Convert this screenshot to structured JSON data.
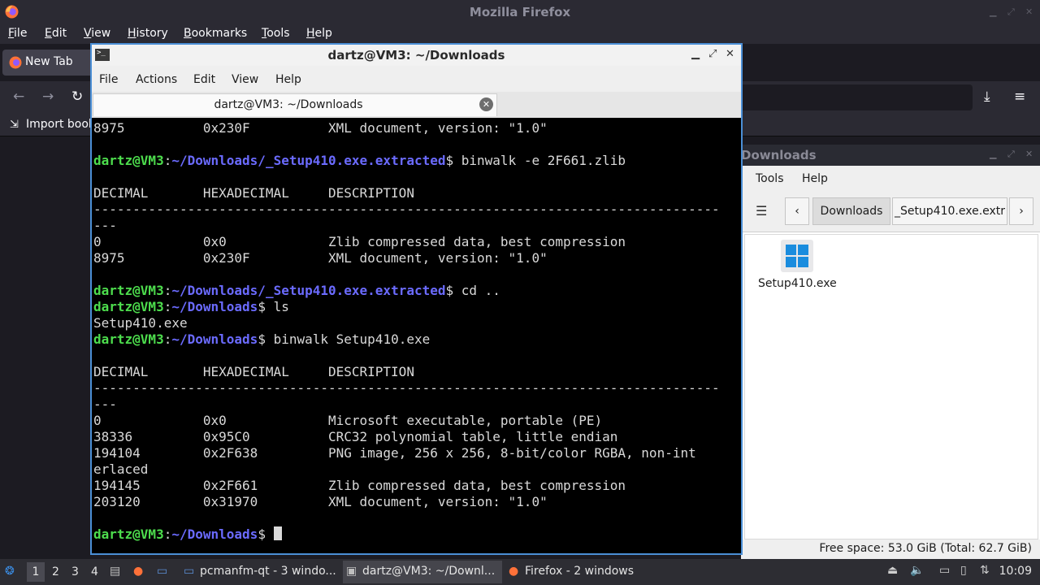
{
  "firefox": {
    "window_title": "Mozilla Firefox",
    "menu": [
      "File",
      "Edit",
      "View",
      "History",
      "Bookmarks",
      "Tools",
      "Help"
    ],
    "tab_label": "New Tab",
    "bookmark_label": "Import book"
  },
  "terminal": {
    "window_title": "dartz@VM3: ~/Downloads",
    "menu": [
      "File",
      "Actions",
      "Edit",
      "View",
      "Help"
    ],
    "tab_title": "dartz@VM3: ~/Downloads",
    "prompt_user": "dartz@VM3",
    "lines": [
      {
        "text": "8975          0x230F          XML document, version: \"1.0\""
      },
      {
        "text": ""
      },
      {
        "prompt_path": "~/Downloads/_Setup410.exe.extracted",
        "cmd": " binwalk -e 2F661.zlib"
      },
      {
        "text": ""
      },
      {
        "text": "DECIMAL       HEXADECIMAL     DESCRIPTION"
      },
      {
        "text": "--------------------------------------------------------------------------------"
      },
      {
        "text": "---"
      },
      {
        "text": "0             0x0             Zlib compressed data, best compression"
      },
      {
        "text": "8975          0x230F          XML document, version: \"1.0\""
      },
      {
        "text": ""
      },
      {
        "prompt_path": "~/Downloads/_Setup410.exe.extracted",
        "cmd": " cd .."
      },
      {
        "prompt_path": "~/Downloads",
        "cmd": " ls"
      },
      {
        "text": "Setup410.exe"
      },
      {
        "prompt_path": "~/Downloads",
        "cmd": " binwalk Setup410.exe"
      },
      {
        "text": ""
      },
      {
        "text": "DECIMAL       HEXADECIMAL     DESCRIPTION"
      },
      {
        "text": "--------------------------------------------------------------------------------"
      },
      {
        "text": "---"
      },
      {
        "text": "0             0x0             Microsoft executable, portable (PE)"
      },
      {
        "text": "38336         0x95C0          CRC32 polynomial table, little endian"
      },
      {
        "text": "194104        0x2F638         PNG image, 256 x 256, 8-bit/color RGBA, non-int"
      },
      {
        "text": "erlaced"
      },
      {
        "text": "194145        0x2F661         Zlib compressed data, best compression"
      },
      {
        "text": "203120        0x31970         XML document, version: \"1.0\""
      },
      {
        "text": ""
      },
      {
        "prompt_path": "~/Downloads",
        "cmd": " ",
        "cursor": true
      }
    ]
  },
  "filemanager": {
    "window_title": "Downloads",
    "menu": [
      "Tools",
      "Help"
    ],
    "path": [
      "Downloads",
      "_Setup410.exe.extr"
    ],
    "file_name": "Setup410.exe",
    "status": "Free space: 53.0 GiB (Total: 62.7 GiB)"
  },
  "taskbar": {
    "desktops": [
      "1",
      "2",
      "3",
      "4"
    ],
    "tasks": [
      "pcmanfm-qt - 3 windo...",
      "dartz@VM3: ~/Downl...",
      "Firefox - 2 windows"
    ],
    "clock": "10:09"
  },
  "colors": {
    "prompt_user": "#4ddd4d",
    "prompt_path": "#6b6bff",
    "terminal_bg": "#000000",
    "active_border": "#4b8fd6"
  }
}
